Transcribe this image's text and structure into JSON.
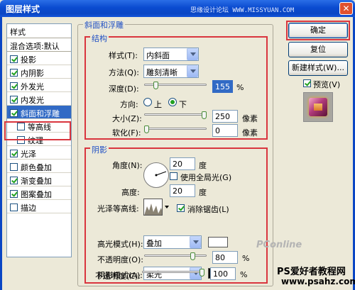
{
  "window": {
    "title": "图层样式",
    "close_glyph": "✕",
    "watermark_top": "思缘设计论坛 WWW.MISSYUAN.COM"
  },
  "stylelist": {
    "header": "样式",
    "blend_item": "混合选项:默认",
    "items": [
      {
        "label": "投影",
        "checked": true
      },
      {
        "label": "内阴影",
        "checked": true
      },
      {
        "label": "外发光",
        "checked": true
      },
      {
        "label": "内发光",
        "checked": true
      },
      {
        "label": "斜面和浮雕",
        "checked": true,
        "selected": true
      },
      {
        "label": "等高线",
        "checked": false,
        "sub": true
      },
      {
        "label": "纹理",
        "checked": false,
        "sub": true
      },
      {
        "label": "光泽",
        "checked": true
      },
      {
        "label": "颜色叠加",
        "checked": false
      },
      {
        "label": "渐变叠加",
        "checked": true
      },
      {
        "label": "图案叠加",
        "checked": true
      },
      {
        "label": "描边",
        "checked": false
      }
    ]
  },
  "bevel": {
    "group_title": "斜面和浮雕",
    "structure_title": "结构",
    "style_label": "样式(T):",
    "style_value": "内斜面",
    "technique_label": "方法(Q):",
    "technique_value": "雕刻清晰",
    "depth_label": "深度(D):",
    "depth_value": "155",
    "depth_unit": "%",
    "depth_level": 0.155,
    "direction_label": "方向:",
    "direction_up": "上",
    "direction_down": "下",
    "direction_selected": "下",
    "size_label": "大小(Z):",
    "size_value": "250",
    "size_unit": "像素",
    "size_level": 1.0,
    "soften_label": "软化(F):",
    "soften_value": "0",
    "soften_unit": "像素",
    "soften_level": 0
  },
  "shading": {
    "title": "阴影",
    "angle_label": "角度(N):",
    "angle_value": "20",
    "angle_unit": "度",
    "global_light_label": "使用全局光(G)",
    "global_light_checked": false,
    "altitude_label": "高度:",
    "altitude_value": "20",
    "altitude_unit": "度",
    "gloss_contour_label": "光泽等高线:",
    "anti_alias_label": "消除锯齿(L)",
    "anti_alias_checked": true,
    "highlight_mode_label": "高光模式(H):",
    "highlight_mode_value": "叠加",
    "highlight_color": "#ffffff",
    "highlight_opacity_label": "不透明度(O):",
    "highlight_opacity_value": "80",
    "highlight_opacity_level": 0.8,
    "shadow_mode_label": "阴影模式(A):",
    "shadow_mode_value": "柔光",
    "shadow_color": "#000000",
    "shadow_opacity_label": "不透明度(C):",
    "shadow_opacity_value": "100",
    "shadow_opacity_level": 1.0,
    "percent_unit": "%"
  },
  "buttons": {
    "ok": "确定",
    "reset": "复位",
    "new_style": "新建样式(W)...",
    "preview_label": "预览(V)",
    "preview_checked": true
  },
  "watermarks": {
    "pconline": "PConline",
    "site_name": "PS爱好者教程网",
    "site_url": "www.psahz.com"
  },
  "colors": {
    "accent_red": "#d9353e",
    "selection": "#316ac5",
    "legend_blue": "#1f4fc4",
    "title_blue": "#0a46c4"
  }
}
